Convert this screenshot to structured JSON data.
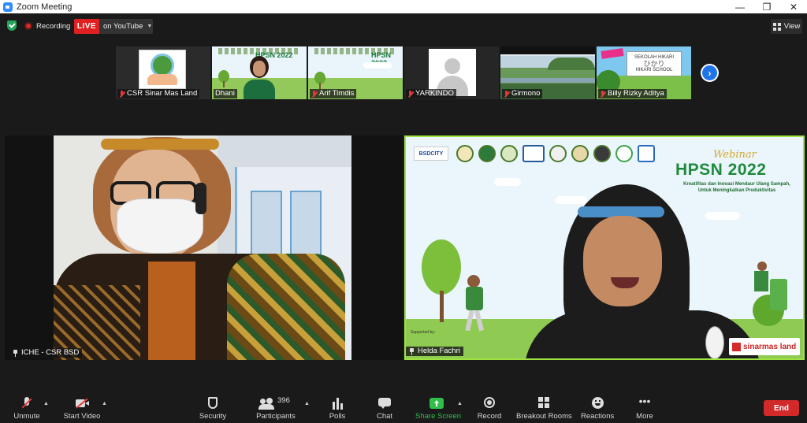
{
  "window": {
    "title": "Zoom Meeting"
  },
  "status": {
    "recording_label": "Recording",
    "live_badge": "LIVE",
    "live_target": "on YouTube",
    "view_label": "View"
  },
  "thumbnails": [
    {
      "name": "CSR Sinar Mas Land"
    },
    {
      "name": "Dhani"
    },
    {
      "name": "Arif Timdis"
    },
    {
      "name": "YARKINDO"
    },
    {
      "name": "Girmono"
    },
    {
      "name": "Billy Rizky Aditya"
    }
  ],
  "thumb_banner": {
    "title": "HPSN 2022"
  },
  "thumb_school": {
    "line1": "SEKOLAH HIKARI",
    "line2": "HIKARI SCHOOL"
  },
  "main_tiles": {
    "left": {
      "name": "ICHE - CSR BSD"
    },
    "right": {
      "name": "Helda Fachri",
      "webinar_script": "Webinar",
      "title": "HPSN 2022",
      "subtitle": "Kreatifitas dan Inovasi Mendaur Ulang Sampah, Untuk Meningkatkan Produktivitas",
      "supported_by": "Supported by:",
      "bsd_logo": "BSDCITY",
      "sponsor": "sinarmas land"
    }
  },
  "toolbar": {
    "unmute": "Unmute",
    "start_video": "Start Video",
    "security": "Security",
    "participants": "Participants",
    "participants_count": "396",
    "polls": "Polls",
    "chat": "Chat",
    "share_screen": "Share Screen",
    "record": "Record",
    "breakout_rooms": "Breakout Rooms",
    "reactions": "Reactions",
    "more": "More",
    "end": "End"
  },
  "colors": {
    "accent_blue": "#1e74e8",
    "live_red": "#e02020",
    "active_speaker_border": "#9fe341",
    "share_green": "#2fbf4a",
    "end_red": "#d22a2a"
  }
}
